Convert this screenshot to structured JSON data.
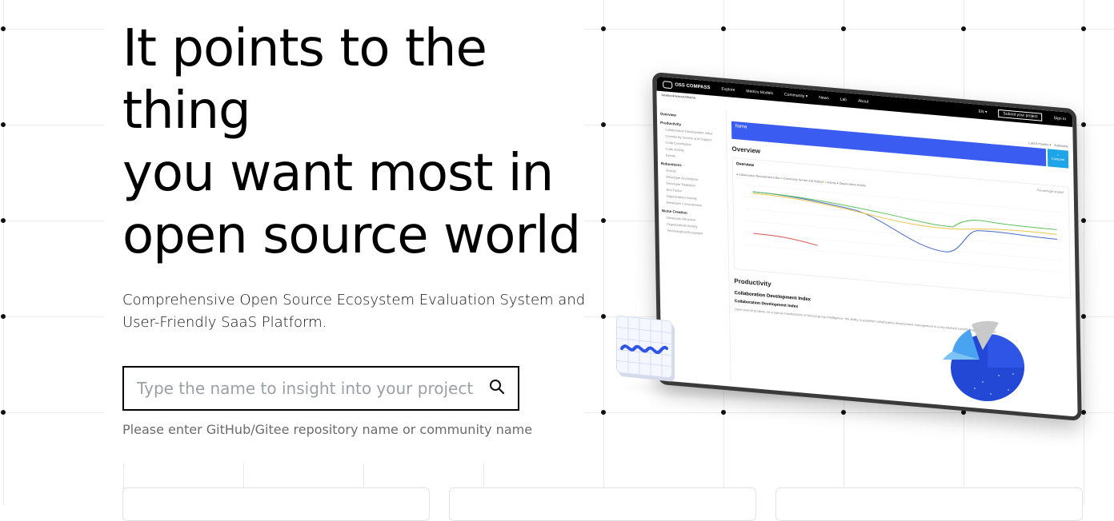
{
  "hero": {
    "title": "It points to the\nthing\nyou want most in\nopen source world",
    "subtitle": "Comprehensive Open Source Ecosystem Evaluation System and User-Friendly SaaS Platform."
  },
  "search": {
    "placeholder": "Type the name to insight into your project",
    "value": "",
    "icon": "search-icon",
    "hint": "Please enter GitHub/Gitee repository name or community name"
  },
  "mockup": {
    "nav": {
      "logo": "OSS COMPASS",
      "items": [
        "Explore",
        "Metrics Models",
        "Community ▾",
        "News",
        "Lab",
        "About"
      ],
      "lang": "EN ▾",
      "submit": "Submit your project",
      "signin": "Sign In"
    },
    "repo": "facebookresearch/llama",
    "tools": {
      "range": "Last 6 months ▾",
      "subscribe": "Subscribe"
    },
    "sidebar": {
      "overview": "Overview",
      "groups": [
        {
          "title": "Productivity",
          "items": [
            "Collaboration Development Index",
            "Community Service and Support",
            "Code Contribution",
            "Code Activity",
            "Events"
          ]
        },
        {
          "title": "Robustness",
          "items": [
            "Activity",
            "Developer Accordance",
            "Developer Retention",
            "Bus Factor",
            "Organizations Activity",
            "Developer Concentration"
          ]
        },
        {
          "title": "Niche Creation",
          "items": [
            "Developer Attraction",
            "Organizations Activity",
            "Technological Ecosystem"
          ]
        }
      ]
    },
    "project_name": "llama",
    "compare": "Compare",
    "section_overview": "Overview",
    "panel_title": "Overview",
    "percentage_label": "Percentage scaled",
    "legend": [
      "Collaboration Development Index",
      "Community Service and Support",
      "Activity",
      "Organizations Activity"
    ],
    "section_productivity": "Productivity",
    "cdi_title": "Collaboration Development Index",
    "cdi_sub": "Collaboration Development Index",
    "cdi_desc": "Open source projects, as a typical manifestation of human group intelligence, the ability to establish collaborative development management is a key element contributing to the success."
  },
  "colors": {
    "accent": "#3a5cf0",
    "compare": "#1ea4e9",
    "series": [
      "#4468c9",
      "#5bbf5b",
      "#e8c546",
      "#d9534f"
    ]
  }
}
